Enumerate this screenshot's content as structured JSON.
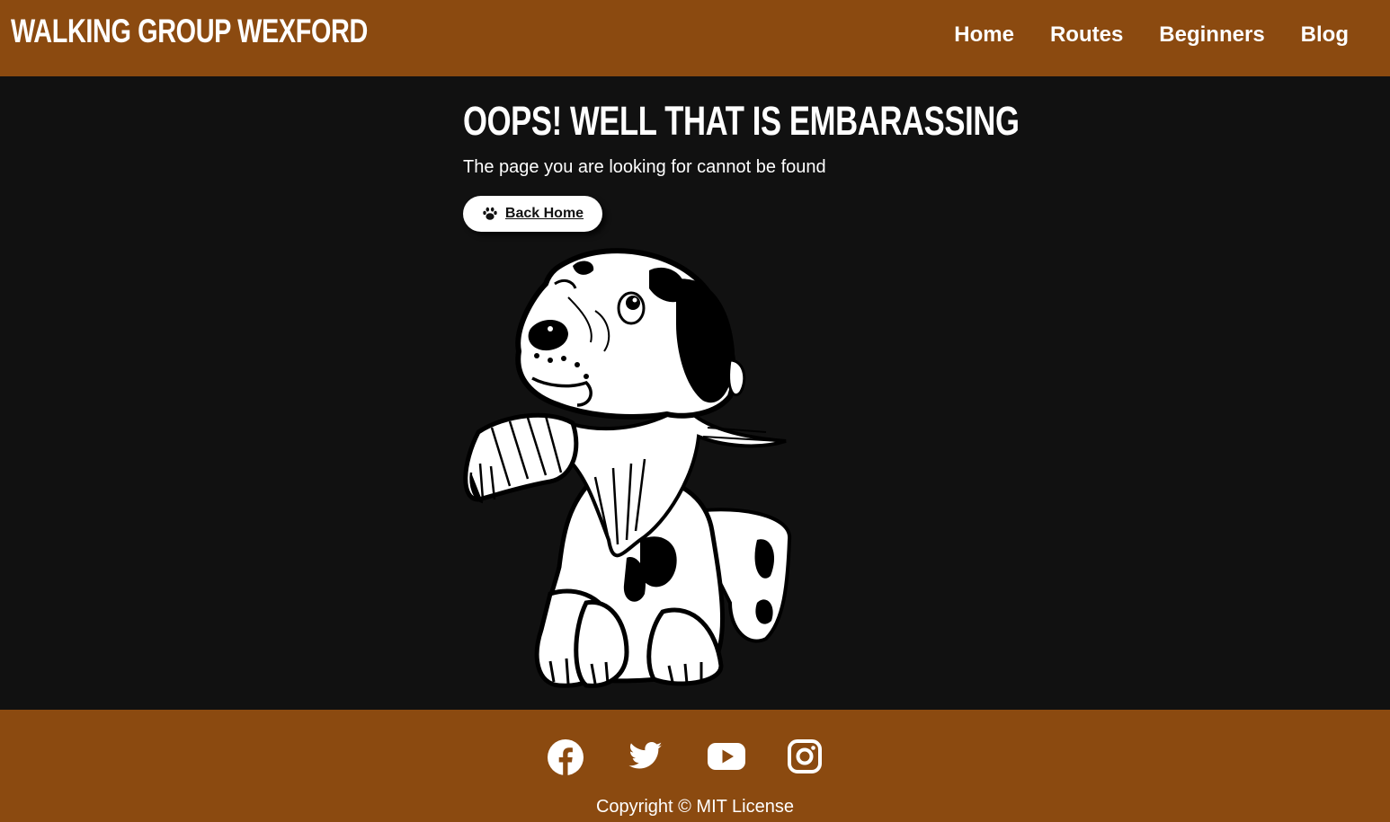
{
  "header": {
    "brand": "WALKING GROUP WEXFORD",
    "nav": [
      {
        "label": "Home"
      },
      {
        "label": "Routes"
      },
      {
        "label": "Beginners"
      },
      {
        "label": "Blog"
      }
    ]
  },
  "main": {
    "title": "OOPS! WELL THAT IS EMBARASSING",
    "subtitle": "The page you are looking for cannot be found",
    "back_button": {
      "label": "Back Home",
      "icon": "paw-icon"
    },
    "image": {
      "icon": "sad-dog-illustration"
    }
  },
  "footer": {
    "socials": [
      {
        "icon": "facebook-icon"
      },
      {
        "icon": "twitter-icon"
      },
      {
        "icon": "youtube-icon"
      },
      {
        "icon": "instagram-icon"
      }
    ],
    "copyright": "Copyright © MIT License"
  },
  "colors": {
    "header_bg": "#8b4a10",
    "footer_bg": "#8b4a10",
    "page_bg": "#111111",
    "text": "#ffffff",
    "button_bg": "#ffffff"
  }
}
